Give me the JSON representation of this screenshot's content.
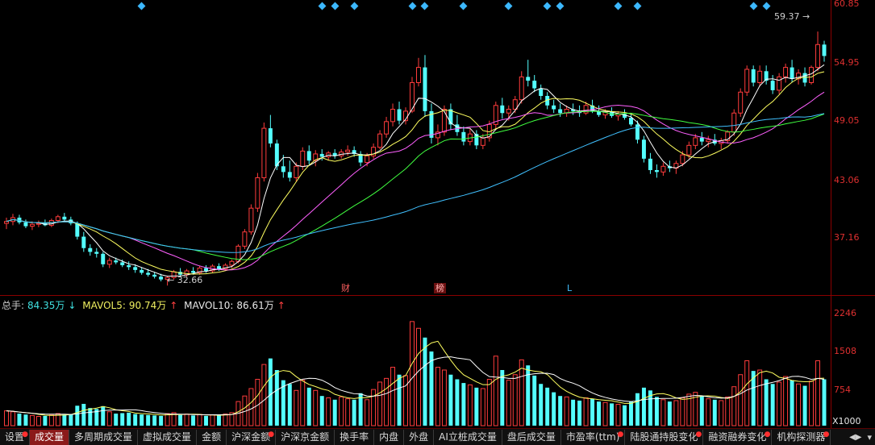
{
  "price_axis": {
    "ticks": [
      "60.85",
      "54.95",
      "49.05",
      "43.06",
      "37.16"
    ]
  },
  "volume_axis": {
    "ticks": [
      "2246",
      "1508",
      "754"
    ],
    "multiplier": "X1000"
  },
  "annotations": {
    "high": "59.37",
    "low": "32.66",
    "marker_cai": "财",
    "marker_bang": "榜",
    "marker_l": "L"
  },
  "volume_legend": {
    "total_label": "总手:",
    "total_value": "84.35万",
    "total_arrow": "↓",
    "ma5_label": "MAVOL5:",
    "ma5_value": "90.74万",
    "ma5_arrow": "↑",
    "ma10_label": "MAVOL10:",
    "ma10_value": "86.61万",
    "ma10_arrow": "↑"
  },
  "tabs": [
    {
      "label": "设置",
      "dot": true,
      "active": false
    },
    {
      "label": "成交量",
      "dot": false,
      "active": true
    },
    {
      "label": "多周期成交量",
      "dot": false,
      "active": false
    },
    {
      "label": "虚拟成交量",
      "dot": false,
      "active": false
    },
    {
      "label": "金额",
      "dot": false,
      "active": false
    },
    {
      "label": "沪深金额",
      "dot": true,
      "active": false
    },
    {
      "label": "沪深京金额",
      "dot": false,
      "active": false
    },
    {
      "label": "换手率",
      "dot": false,
      "active": false
    },
    {
      "label": "内盘",
      "dot": false,
      "active": false
    },
    {
      "label": "外盘",
      "dot": false,
      "active": false
    },
    {
      "label": "AI立桩成交量",
      "dot": false,
      "active": false
    },
    {
      "label": "盘后成交量",
      "dot": false,
      "active": false
    },
    {
      "label": "市盈率(ttm)",
      "dot": true,
      "active": false
    },
    {
      "label": "陆股通持股变化",
      "dot": true,
      "active": false
    },
    {
      "label": "融资融券变化",
      "dot": true,
      "active": false
    },
    {
      "label": "机构探测器",
      "dot": true,
      "active": false
    }
  ],
  "colors": {
    "up": "#ff3c3c",
    "down": "#54ffff",
    "ma5": "#ffffff",
    "ma10": "#ffff60",
    "ma20": "#ff60ff",
    "ma30": "#40ff40",
    "ma60": "#40c0ff",
    "event_marker": "#3cb8ff"
  },
  "chart_data": {
    "type": "candlestick",
    "price_range": [
      32.0,
      61.5
    ],
    "volume_range": [
      0,
      2400
    ],
    "candles": [
      [
        39.2,
        39.8,
        38.6,
        39.4,
        320
      ],
      [
        39.4,
        40.2,
        39.0,
        39.8,
        300
      ],
      [
        39.8,
        40.1,
        39.1,
        39.3,
        260
      ],
      [
        39.3,
        39.6,
        38.7,
        38.9,
        240
      ],
      [
        38.9,
        39.4,
        38.5,
        39.1,
        220
      ],
      [
        39.1,
        39.5,
        38.8,
        39.2,
        200
      ],
      [
        39.2,
        39.6,
        38.9,
        39.0,
        210
      ],
      [
        39.0,
        39.7,
        38.8,
        39.5,
        230
      ],
      [
        39.5,
        40.1,
        39.2,
        39.9,
        260
      ],
      [
        39.9,
        40.3,
        39.4,
        39.6,
        240
      ],
      [
        39.6,
        39.9,
        39.0,
        39.2,
        250
      ],
      [
        39.2,
        39.4,
        37.5,
        37.8,
        430
      ],
      [
        37.8,
        38.3,
        36.2,
        36.6,
        470
      ],
      [
        36.6,
        37.0,
        35.8,
        36.2,
        380
      ],
      [
        36.2,
        36.6,
        35.6,
        36.0,
        360
      ],
      [
        36.0,
        36.2,
        34.6,
        34.9,
        420
      ],
      [
        34.9,
        35.6,
        34.5,
        35.3,
        300
      ],
      [
        35.3,
        35.6,
        34.9,
        35.1,
        260
      ],
      [
        35.1,
        35.4,
        34.6,
        34.8,
        270
      ],
      [
        34.8,
        35.2,
        34.3,
        34.6,
        280
      ],
      [
        34.6,
        34.9,
        34.0,
        34.3,
        250
      ],
      [
        34.3,
        34.6,
        33.8,
        34.0,
        240
      ],
      [
        34.0,
        34.4,
        33.6,
        33.8,
        230
      ],
      [
        33.8,
        34.1,
        33.4,
        33.6,
        220
      ],
      [
        33.6,
        33.9,
        33.1,
        33.3,
        210
      ],
      [
        33.3,
        33.7,
        32.66,
        33.5,
        260
      ],
      [
        33.5,
        34.3,
        33.3,
        34.1,
        280
      ],
      [
        34.1,
        34.5,
        33.6,
        33.8,
        230
      ],
      [
        33.8,
        34.4,
        33.6,
        34.2,
        250
      ],
      [
        34.2,
        34.6,
        33.8,
        34.0,
        220
      ],
      [
        34.0,
        34.7,
        33.8,
        34.5,
        240
      ],
      [
        34.5,
        34.8,
        34.0,
        34.2,
        210
      ],
      [
        34.2,
        34.9,
        34.0,
        34.7,
        230
      ],
      [
        34.7,
        35.0,
        34.2,
        34.4,
        220
      ],
      [
        34.4,
        35.0,
        34.2,
        34.8,
        250
      ],
      [
        34.8,
        35.4,
        34.5,
        35.2,
        280
      ],
      [
        35.2,
        37.0,
        35.0,
        36.8,
        520
      ],
      [
        36.8,
        38.6,
        36.5,
        38.3,
        640
      ],
      [
        38.3,
        41.2,
        38.0,
        40.8,
        800
      ],
      [
        40.8,
        44.5,
        40.4,
        44.0,
        1000
      ],
      [
        44.0,
        49.8,
        43.6,
        49.2,
        1320
      ],
      [
        49.2,
        50.6,
        47.2,
        47.6,
        1450
      ],
      [
        47.6,
        48.0,
        44.8,
        45.2,
        1200
      ],
      [
        45.2,
        46.4,
        44.0,
        44.6,
        980
      ],
      [
        44.6,
        45.8,
        43.6,
        44.0,
        900
      ],
      [
        44.0,
        45.6,
        43.6,
        45.2,
        760
      ],
      [
        45.2,
        47.2,
        44.8,
        46.8,
        980
      ],
      [
        46.8,
        47.4,
        45.4,
        45.8,
        820
      ],
      [
        45.8,
        46.9,
        45.2,
        46.5,
        760
      ],
      [
        46.5,
        47.0,
        45.8,
        46.2,
        640
      ],
      [
        46.2,
        46.8,
        45.8,
        46.6,
        600
      ],
      [
        46.6,
        47.0,
        46.0,
        46.3,
        560
      ],
      [
        46.3,
        47.0,
        46.0,
        46.7,
        620
      ],
      [
        46.7,
        47.4,
        46.3,
        46.9,
        580
      ],
      [
        46.9,
        47.3,
        46.2,
        46.5,
        560
      ],
      [
        46.5,
        46.8,
        45.2,
        45.6,
        700
      ],
      [
        45.6,
        46.6,
        45.2,
        46.3,
        560
      ],
      [
        46.3,
        47.6,
        46.0,
        47.2,
        780
      ],
      [
        47.2,
        49.0,
        47.0,
        48.6,
        940
      ],
      [
        48.6,
        50.4,
        48.2,
        49.9,
        1020
      ],
      [
        49.9,
        51.8,
        49.4,
        51.2,
        1260
      ],
      [
        51.2,
        52.0,
        49.6,
        50.0,
        1100
      ],
      [
        50.0,
        51.4,
        49.6,
        51.0,
        1080
      ],
      [
        51.0,
        54.6,
        50.8,
        54.0,
        2246
      ],
      [
        54.0,
        56.6,
        53.6,
        55.6,
        2100
      ],
      [
        55.6,
        56.9,
        50.4,
        51.0,
        1900
      ],
      [
        51.0,
        51.8,
        47.6,
        48.2,
        1600
      ],
      [
        48.2,
        49.6,
        47.4,
        48.8,
        1260
      ],
      [
        48.8,
        51.6,
        48.4,
        51.2,
        1200
      ],
      [
        51.2,
        51.8,
        49.0,
        49.6,
        1100
      ],
      [
        49.6,
        50.6,
        48.4,
        48.8,
        1000
      ],
      [
        48.8,
        49.4,
        47.4,
        47.8,
        920
      ],
      [
        47.8,
        49.2,
        47.4,
        48.6,
        880
      ],
      [
        48.6,
        49.0,
        47.0,
        47.4,
        820
      ],
      [
        47.4,
        48.6,
        47.0,
        48.2,
        800
      ],
      [
        48.2,
        50.0,
        47.8,
        49.6,
        1000
      ],
      [
        49.6,
        52.0,
        49.2,
        51.6,
        1500
      ],
      [
        51.6,
        52.4,
        50.2,
        50.8,
        1200
      ],
      [
        50.8,
        51.6,
        50.0,
        51.2,
        980
      ],
      [
        51.2,
        52.6,
        50.8,
        52.2,
        1100
      ],
      [
        52.2,
        55.2,
        51.8,
        54.6,
        1420
      ],
      [
        54.6,
        56.4,
        53.6,
        54.2,
        1300
      ],
      [
        54.2,
        54.8,
        53.0,
        53.4,
        1080
      ],
      [
        53.4,
        53.8,
        52.2,
        52.6,
        900
      ],
      [
        52.6,
        53.0,
        51.2,
        51.6,
        820
      ],
      [
        51.6,
        52.2,
        50.8,
        51.2,
        720
      ],
      [
        51.2,
        51.8,
        50.4,
        50.8,
        640
      ],
      [
        50.8,
        51.6,
        50.4,
        51.2,
        620
      ],
      [
        51.2,
        51.8,
        50.6,
        51.0,
        560
      ],
      [
        51.0,
        51.6,
        50.4,
        50.8,
        540
      ],
      [
        50.8,
        52.0,
        50.6,
        51.6,
        600
      ],
      [
        51.6,
        52.2,
        50.8,
        51.0,
        580
      ],
      [
        51.0,
        51.6,
        50.4,
        50.6,
        520
      ],
      [
        50.6,
        51.2,
        50.2,
        50.9,
        500
      ],
      [
        50.9,
        51.4,
        50.3,
        50.5,
        480
      ],
      [
        50.5,
        51.0,
        50.0,
        50.7,
        460
      ],
      [
        50.7,
        51.2,
        50.1,
        50.3,
        440
      ],
      [
        50.3,
        50.8,
        49.4,
        49.6,
        520
      ],
      [
        49.6,
        50.0,
        47.6,
        48.0,
        700
      ],
      [
        48.0,
        48.4,
        45.6,
        46.0,
        820
      ],
      [
        46.0,
        46.6,
        44.4,
        44.8,
        760
      ],
      [
        44.8,
        45.4,
        44.0,
        44.6,
        620
      ],
      [
        44.6,
        45.6,
        44.2,
        45.2,
        560
      ],
      [
        45.2,
        45.8,
        44.6,
        45.0,
        520
      ],
      [
        45.0,
        45.8,
        44.4,
        45.5,
        540
      ],
      [
        45.5,
        46.8,
        45.2,
        46.4,
        600
      ],
      [
        46.4,
        47.8,
        46.0,
        47.4,
        680
      ],
      [
        47.4,
        48.6,
        47.0,
        48.2,
        720
      ],
      [
        48.2,
        48.8,
        47.4,
        47.8,
        640
      ],
      [
        47.8,
        48.4,
        47.2,
        48.0,
        580
      ],
      [
        48.0,
        48.6,
        47.4,
        47.6,
        560
      ],
      [
        47.6,
        48.2,
        47.0,
        47.9,
        540
      ],
      [
        47.9,
        49.0,
        47.6,
        48.8,
        620
      ],
      [
        48.8,
        51.2,
        48.4,
        50.8,
        840
      ],
      [
        50.8,
        53.4,
        50.4,
        53.0,
        1100
      ],
      [
        53.0,
        55.8,
        52.6,
        55.4,
        1400
      ],
      [
        55.4,
        55.8,
        53.6,
        54.0,
        1180
      ],
      [
        54.0,
        55.8,
        53.6,
        55.2,
        1200
      ],
      [
        55.2,
        55.8,
        53.8,
        54.2,
        1000
      ],
      [
        54.2,
        54.8,
        52.8,
        53.2,
        900
      ],
      [
        53.2,
        55.0,
        52.8,
        54.6,
        940
      ],
      [
        54.6,
        56.0,
        54.0,
        55.6,
        1060
      ],
      [
        55.6,
        56.4,
        54.0,
        54.4,
        980
      ],
      [
        54.4,
        55.4,
        53.8,
        55.0,
        900
      ],
      [
        55.0,
        55.6,
        53.6,
        54.0,
        860
      ],
      [
        54.0,
        55.8,
        53.8,
        55.6,
        960
      ],
      [
        55.6,
        59.37,
        55.2,
        58.0,
        1400
      ],
      [
        58.0,
        58.4,
        56.2,
        56.8,
        1000
      ]
    ],
    "event_marker_indices": [
      21,
      49,
      51,
      54,
      63,
      65,
      71,
      78,
      84,
      86,
      95,
      98,
      116,
      118
    ]
  }
}
